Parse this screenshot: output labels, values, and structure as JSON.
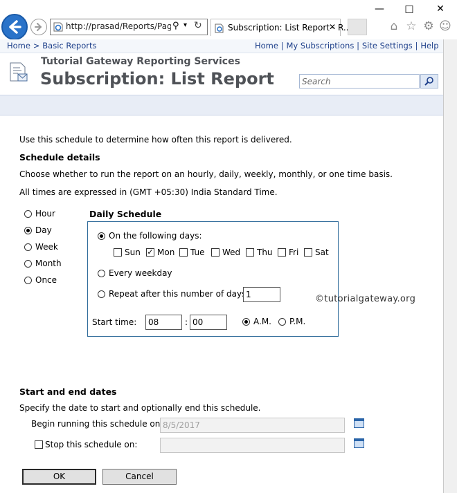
{
  "browser": {
    "address": "http://prasad/Reports/Pages",
    "tab_title": "Subscription: List Report - R...",
    "window_controls": [
      "minimize",
      "maximize",
      "close"
    ],
    "toolbar_icons": [
      "home-icon",
      "star-icon",
      "gear-icon",
      "smiley-icon"
    ]
  },
  "breadcrumb": {
    "home": "Home",
    "sep": ">",
    "current": "Basic Reports"
  },
  "top_links": {
    "home": "Home",
    "subscriptions": "My Subscriptions",
    "site_settings": "Site Settings",
    "help": "Help",
    "sep": "|"
  },
  "header": {
    "site_name": "Tutorial Gateway Reporting Services",
    "title": "Subscription: List Report",
    "search_placeholder": "Search"
  },
  "content": {
    "intro": "Use this schedule to determine how often this report is delivered.",
    "schedule_details_heading": "Schedule details",
    "schedule_help": "Choose whether to run the report on an hourly, daily, weekly, monthly, or one time basis.",
    "timezone": "All times are expressed in (GMT +05:30) India Standard Time."
  },
  "frequency": {
    "options": [
      "Hour",
      "Day",
      "Week",
      "Month",
      "Once"
    ],
    "selected": "Day"
  },
  "daily_schedule": {
    "heading": "Daily Schedule",
    "on_days_label": "On the following days:",
    "days": [
      "Sun",
      "Mon",
      "Tue",
      "Wed",
      "Thu",
      "Fri",
      "Sat"
    ],
    "days_checked": [
      "Mon"
    ],
    "every_weekday_label": "Every weekday",
    "repeat_label": "Repeat after this number of days:",
    "repeat_value": "1",
    "start_time_label": "Start time:",
    "hour": "08",
    "minute": "00",
    "time_sep": ":",
    "am_label": "A.M.",
    "pm_label": "P.M.",
    "selected_option": "On the following days",
    "selected_meridiem": "A.M."
  },
  "watermark": "©tutorialgateway.org",
  "dates": {
    "heading": "Start and end dates",
    "help": "Specify the date to start and optionally end this schedule.",
    "begin_label": "Begin running this schedule on:",
    "begin_value": "8/5/2017",
    "stop_label": "Stop this schedule on:",
    "stop_value": "",
    "stop_checked": false
  },
  "actions": {
    "ok": "OK",
    "cancel": "Cancel"
  }
}
